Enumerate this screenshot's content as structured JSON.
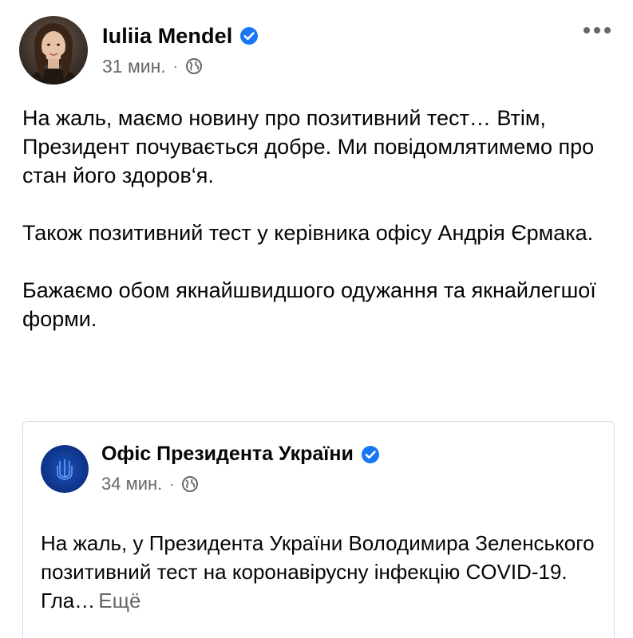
{
  "post": {
    "author_name": "Iuliia Mendel",
    "time": "31 мин.",
    "separator": "·",
    "visibility_icon": "globe-icon",
    "verified_icon": "verified-badge-icon",
    "more_icon": "more-options-icon",
    "text": {
      "p1": "На жаль, маємо новину про позитивний тест… Втім, Президент почувається добре. Ми повідомлятимемо про стан його здоров‘я.",
      "p2": "Також позитивний тест у керівника офісу Андрія Єрмака.",
      "p3": "Бажаємо обом якнайшвидшого одужання та якнайлегшої форми."
    }
  },
  "shared_post": {
    "page_name": "Офіс Президента України",
    "time": "34 мин.",
    "separator": "·",
    "visibility_icon": "globe-icon",
    "text": "На жаль, у Президента України Володимира Зеленського позитивний тест на коронавірусну інфекцію COVID-19. Гла…",
    "see_more": "Ещё"
  },
  "colors": {
    "text_primary": "#050505",
    "text_secondary": "#65676b",
    "verified_blue": "#1877f2",
    "border": "#dadde1"
  }
}
